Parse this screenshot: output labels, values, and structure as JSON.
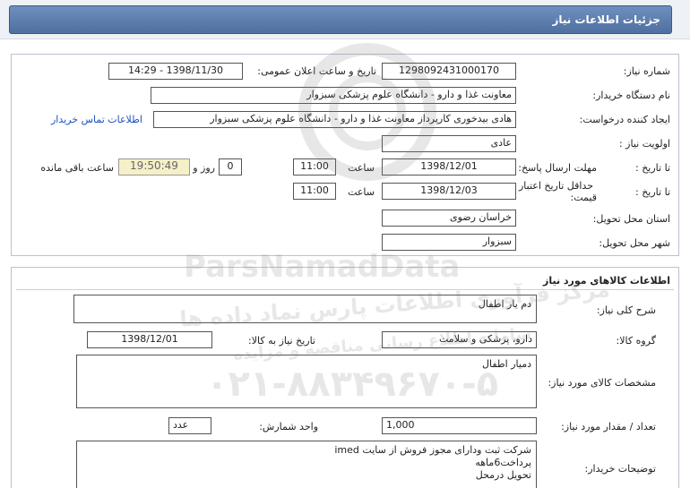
{
  "page_title": "جزئیات اطلاعات نیاز",
  "info": {
    "need_number_label": "شماره نیاز:",
    "need_number": "1298092431000170",
    "announce_label": "تاریخ و ساعت اعلان عمومی:",
    "announce_value": "1398/11/30 - 14:29",
    "buyer_org_label": "نام دستگاه خریدار:",
    "buyer_org": "معاونت غذا و دارو - دانشگاه علوم پزشکی سبزوار",
    "creator_label": "ایجاد کننده درخواست:",
    "creator": "هادی بیدخوری کارپرداز معاونت غذا و دارو - دانشگاه علوم پزشکی سبزوار",
    "contact_link": "اطلاعات تماس خریدار",
    "priority_label": "اولویت نیاز :",
    "priority": "عادی",
    "deadline_label": "مهلت ارسال پاسخ:",
    "until_date_label": "تا تاریخ :",
    "deadline_date": "1398/12/01",
    "time_label": "ساعت",
    "deadline_time": "11:00",
    "days_value": "0",
    "days_label": "روز و",
    "remaining_time": "19:50:49",
    "remaining_label": "ساعت باقی مانده",
    "validity_label_line1": "حداقل تاریخ اعتبار",
    "validity_label_line2": "قیمت:",
    "validity_until_label": "تا تاریخ :",
    "validity_date": "1398/12/03",
    "validity_time_label": "ساعت",
    "validity_time": "11:00",
    "province_label": "استان محل تحویل:",
    "province": "خراسان رضوی",
    "city_label": "شهر محل تحویل:",
    "city": "سبزوار"
  },
  "goods": {
    "section_title": "اطلاعات کالاهای مورد نیاز",
    "summary_label": "شرح کلی نیاز:",
    "summary": "دم یار اطفال",
    "group_label": "گروه کالا:",
    "group": "دارو، پزشکی و سلامت",
    "need_date_label": "تاریخ نیاز به کالا:",
    "need_date": "1398/12/01",
    "spec_label": "مشخصات کالای مورد نیاز:",
    "spec": "دمیار اطفال",
    "qty_label": "تعداد / مقدار مورد نیاز:",
    "qty": "1,000",
    "unit_label": "واحد شمارش:",
    "unit": "عدد",
    "buyer_notes_label": "توضیحات خریدار:",
    "buyer_notes_line1": "شرکت ثبت ودارای مجوز فروش از سایت imed",
    "buyer_notes_line2": "پرداخت6ماهه",
    "buyer_notes_line3": "تحویل درمحل"
  },
  "watermark": {
    "brand": "ParsNamadData",
    "tagline": "مرکز فرآوری اطلاعات پارس نماد داده ها",
    "tagline2": "سامانه اطلاع رسانی مناقصه و مزایده",
    "phone": "۰۲۱-۸۸۳۴۹۶۷۰-۵"
  }
}
